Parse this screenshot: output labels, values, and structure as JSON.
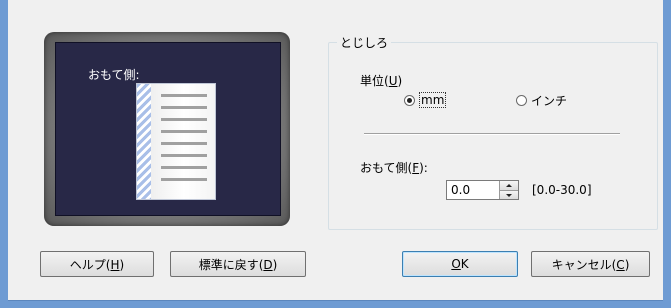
{
  "preview": {
    "side_label": "おもて側:"
  },
  "group": {
    "title": "とじしろ",
    "unit_label_prefix": "単位(",
    "unit_label_key": "U",
    "unit_label_suffix": ")",
    "unit_options": [
      {
        "label": "mm",
        "selected": true
      },
      {
        "label": "インチ",
        "selected": false
      }
    ],
    "front_label_prefix": "おもて側(",
    "front_label_key": "F",
    "front_label_suffix": "):",
    "front_value": "0.0",
    "front_range": "[0.0-30.0]"
  },
  "buttons": {
    "help_prefix": "ヘルプ(",
    "help_key": "H",
    "help_suffix": ")",
    "reset_prefix": "標準に戻す(",
    "reset_key": "D",
    "reset_suffix": ")",
    "ok_key": "O",
    "ok_rest": "K",
    "cancel_prefix": "キャンセル(",
    "cancel_key": "C",
    "cancel_suffix": ")"
  }
}
